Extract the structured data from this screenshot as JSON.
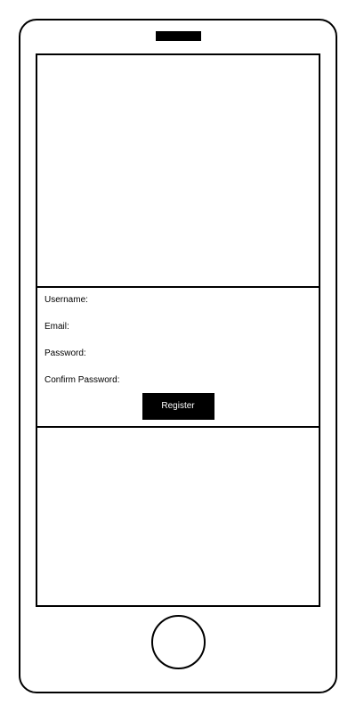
{
  "registration_form": {
    "username_label": "Username:",
    "email_label": "Email:",
    "password_label": "Password:",
    "confirm_password_label": "Confirm Password:",
    "register_button_label": "Register"
  },
  "colors": {
    "frame": "#000000",
    "background": "#ffffff",
    "button_background": "#000000",
    "button_text": "#ffffff"
  }
}
